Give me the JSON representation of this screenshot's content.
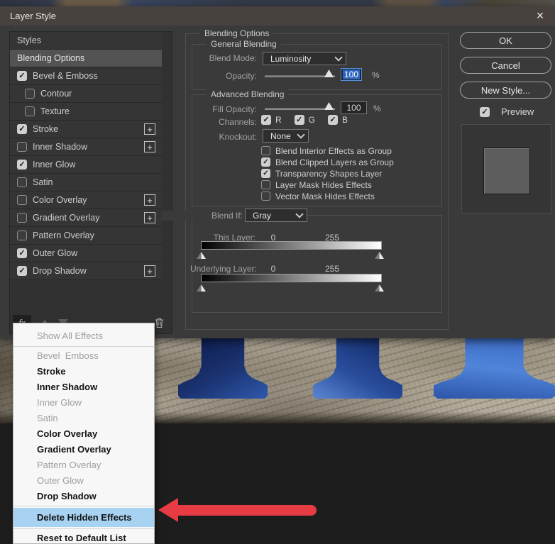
{
  "window": {
    "title": "Layer Style"
  },
  "icons": {
    "close": "×",
    "plus": "+",
    "check": "✓",
    "fx": "fx",
    "move_up": "move-up-arrow",
    "move_down": "move-down-arrow",
    "trash": "trash-outline"
  },
  "sidebar": {
    "items": [
      {
        "label": "Styles",
        "checkbox": null,
        "selected": false,
        "indent": false,
        "plus": false
      },
      {
        "label": "Blending Options",
        "checkbox": null,
        "selected": true,
        "indent": false,
        "plus": false
      },
      {
        "label": "Bevel & Emboss",
        "checkbox": "checked",
        "selected": false,
        "indent": false,
        "plus": false
      },
      {
        "label": "Contour",
        "checkbox": "unchecked",
        "selected": false,
        "indent": true,
        "plus": false
      },
      {
        "label": "Texture",
        "checkbox": "unchecked",
        "selected": false,
        "indent": true,
        "plus": false
      },
      {
        "label": "Stroke",
        "checkbox": "checked",
        "selected": false,
        "indent": false,
        "plus": true
      },
      {
        "label": "Inner Shadow",
        "checkbox": "unchecked",
        "selected": false,
        "indent": false,
        "plus": true
      },
      {
        "label": "Inner Glow",
        "checkbox": "checked",
        "selected": false,
        "indent": false,
        "plus": false
      },
      {
        "label": "Satin",
        "checkbox": "unchecked",
        "selected": false,
        "indent": false,
        "plus": false
      },
      {
        "label": "Color Overlay",
        "checkbox": "unchecked",
        "selected": false,
        "indent": false,
        "plus": true
      },
      {
        "label": "Gradient Overlay",
        "checkbox": "unchecked",
        "selected": false,
        "indent": false,
        "plus": true
      },
      {
        "label": "Pattern Overlay",
        "checkbox": "unchecked",
        "selected": false,
        "indent": false,
        "plus": false
      },
      {
        "label": "Outer Glow",
        "checkbox": "checked",
        "selected": false,
        "indent": false,
        "plus": false
      },
      {
        "label": "Drop Shadow",
        "checkbox": "checked",
        "selected": false,
        "indent": false,
        "plus": true
      }
    ]
  },
  "main": {
    "section_title": "Blending Options",
    "general": {
      "title": "General Blending",
      "blend_mode_label": "Blend Mode:",
      "blend_mode_value": "Luminosity",
      "opacity_label": "Opacity:",
      "opacity_value": "100",
      "opacity_unit": "%"
    },
    "advanced": {
      "title": "Advanced Blending",
      "fill_opacity_label": "Fill Opacity:",
      "fill_opacity_value": "100",
      "fill_opacity_unit": "%",
      "channels_label": "Channels:",
      "channels": [
        {
          "label": "R",
          "checked": true
        },
        {
          "label": "G",
          "checked": true
        },
        {
          "label": "B",
          "checked": true
        }
      ],
      "knockout_label": "Knockout:",
      "knockout_value": "None",
      "options": [
        {
          "label": "Blend Interior Effects as Group",
          "checked": false
        },
        {
          "label": "Blend Clipped Layers as Group",
          "checked": true
        },
        {
          "label": "Transparency Shapes Layer",
          "checked": true
        },
        {
          "label": "Layer Mask Hides Effects",
          "checked": false
        },
        {
          "label": "Vector Mask Hides Effects",
          "checked": false
        }
      ]
    },
    "blend_if": {
      "label": "Blend If:",
      "value": "Gray",
      "this_layer_label": "This Layer:",
      "this_layer_min": "0",
      "this_layer_max": "255",
      "underlying_label": "Underlying Layer:",
      "underlying_min": "0",
      "underlying_max": "255"
    }
  },
  "actions": {
    "ok": "OK",
    "cancel": "Cancel",
    "new_style": "New Style...",
    "preview_label": "Preview",
    "preview_checked": true
  },
  "context_menu": {
    "items": [
      {
        "label": "Show All Effects",
        "style": "muted"
      },
      {
        "separator": true
      },
      {
        "label": "Bevel  Emboss",
        "style": "muted"
      },
      {
        "label": "Stroke",
        "style": "normal"
      },
      {
        "label": "Inner Shadow",
        "style": "normal"
      },
      {
        "label": "Inner Glow",
        "style": "muted"
      },
      {
        "label": "Satin",
        "style": "muted"
      },
      {
        "label": "Color Overlay",
        "style": "normal"
      },
      {
        "label": "Gradient Overlay",
        "style": "normal"
      },
      {
        "label": "Pattern Overlay",
        "style": "muted"
      },
      {
        "label": "Outer Glow",
        "style": "muted"
      },
      {
        "label": "Drop Shadow",
        "style": "normal"
      },
      {
        "separator": true
      },
      {
        "label": "Delete Hidden Effects",
        "style": "highlighted"
      },
      {
        "separator": true
      },
      {
        "label": "Reset to Default List",
        "style": "normal"
      }
    ]
  },
  "colors": {
    "selection_blue": "#2d66c2",
    "menu_highlight": "#a8d2f2",
    "arrow_red": "#e73c44"
  }
}
